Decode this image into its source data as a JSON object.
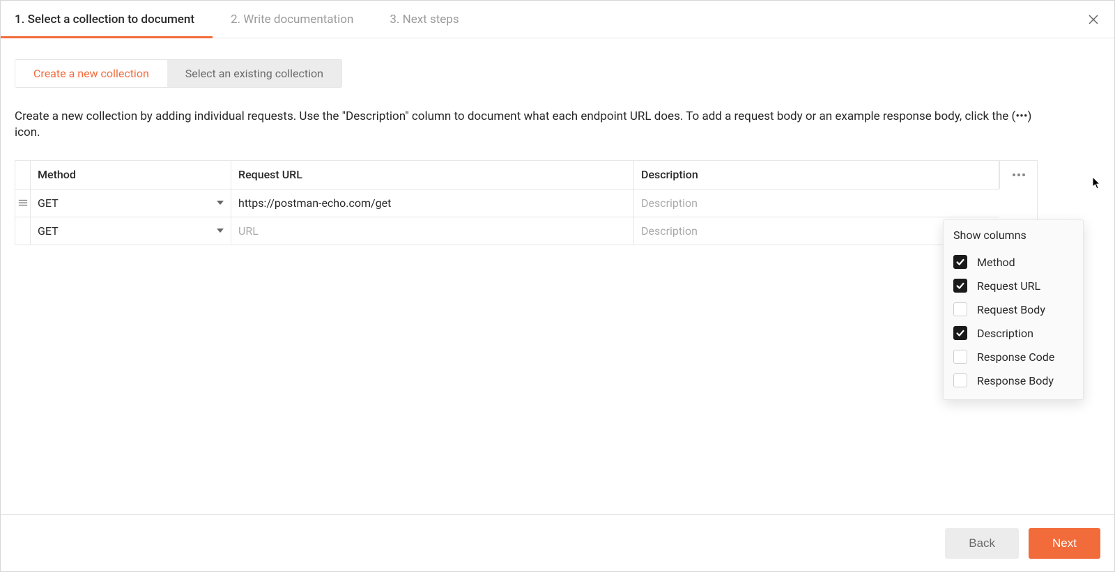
{
  "wizard_steps": {
    "step1": "1. Select a collection to document",
    "step2": "2. Write documentation",
    "step3": "3. Next steps"
  },
  "segmented": {
    "create": "Create a new collection",
    "select": "Select an existing collection"
  },
  "instructions": "Create a new collection by adding individual requests. Use the \"Description\" column to document what each endpoint URL does. To add a request body or an example response body, click the (•••) icon.",
  "table": {
    "headers": {
      "method": "Method",
      "url": "Request URL",
      "desc": "Description"
    },
    "rows": [
      {
        "method": "GET",
        "url": "https://postman-echo.com/get",
        "desc": "",
        "desc_placeholder": "Description"
      },
      {
        "method": "GET",
        "url": "",
        "url_placeholder": "URL",
        "desc": "",
        "desc_placeholder": "Description"
      }
    ]
  },
  "dropdown": {
    "title": "Show columns",
    "items": [
      {
        "label": "Method",
        "checked": true
      },
      {
        "label": "Request URL",
        "checked": true
      },
      {
        "label": "Request Body",
        "checked": false
      },
      {
        "label": "Description",
        "checked": true
      },
      {
        "label": "Response Code",
        "checked": false
      },
      {
        "label": "Response Body",
        "checked": false
      }
    ]
  },
  "footer": {
    "back": "Back",
    "next": "Next"
  }
}
